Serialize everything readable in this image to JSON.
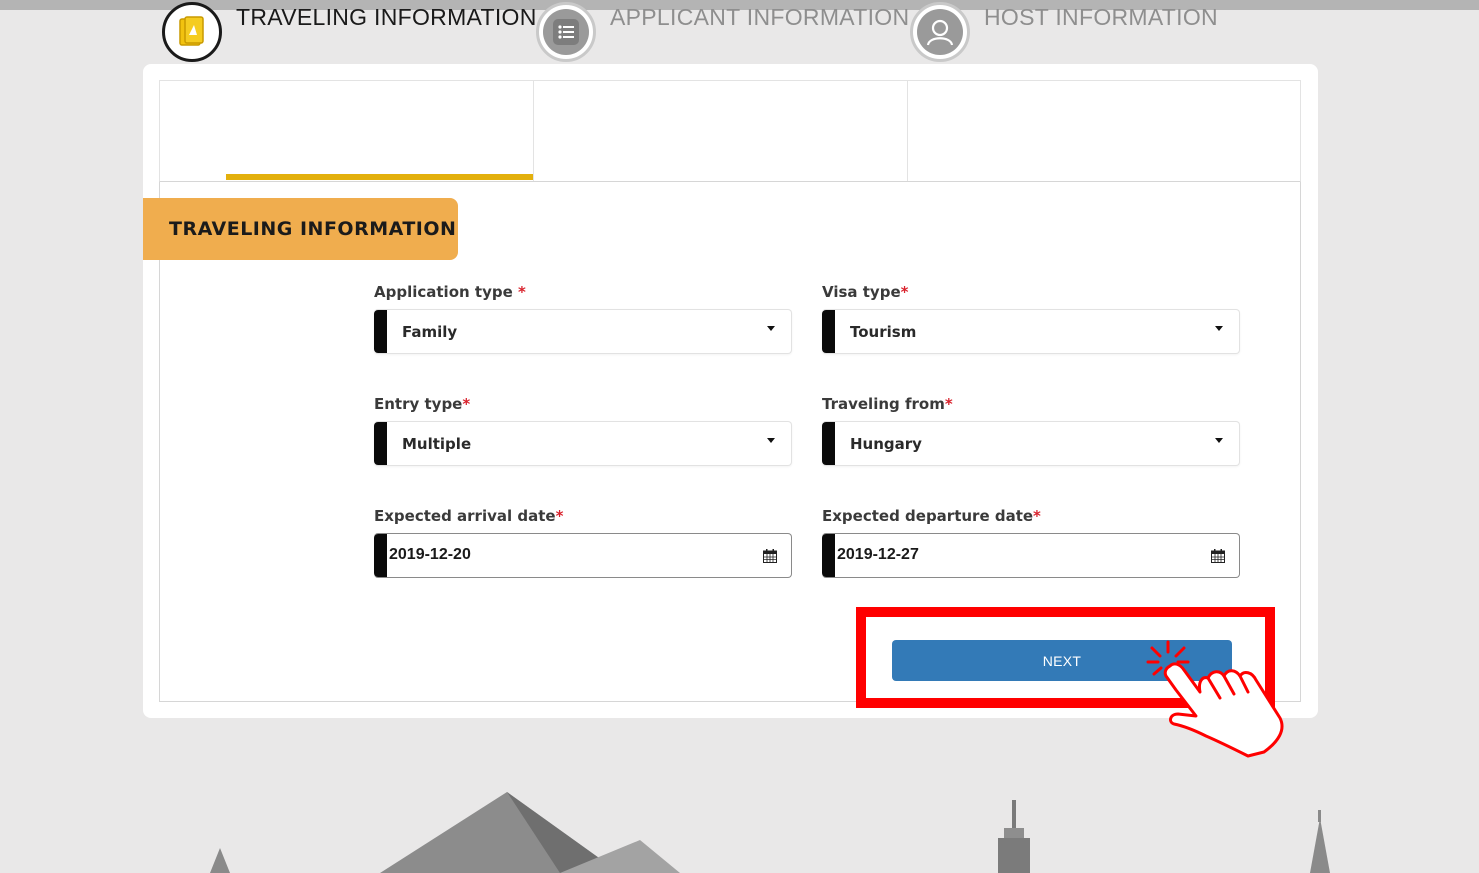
{
  "steps": [
    {
      "label": "TRAVELING INFORMATION",
      "icon": "passport-icon",
      "state": "active"
    },
    {
      "label": "APPLICANT INFORMATION",
      "icon": "list-icon",
      "state": "inactive"
    },
    {
      "label": "HOST INFORMATION",
      "icon": "user-icon",
      "state": "inactive"
    }
  ],
  "section": {
    "title": "TRAVELING INFORMATION"
  },
  "form": {
    "application_type": {
      "label": "Application type ",
      "required": "*",
      "value": "Family"
    },
    "visa_type": {
      "label": "Visa type",
      "required": "*",
      "value": "Tourism"
    },
    "entry_type": {
      "label": "Entry type",
      "required": "*",
      "value": "Multiple"
    },
    "traveling_from": {
      "label": "Traveling from",
      "required": "*",
      "value": "Hungary"
    },
    "arrival_date": {
      "label": "Expected arrival date",
      "required": "*",
      "value": "2019-12-20"
    },
    "departure_date": {
      "label": "Expected departure date",
      "required": "*",
      "value": "2019-12-27"
    }
  },
  "next_button": {
    "label": "NEXT"
  },
  "colors": {
    "accent": "#e3b00d",
    "section_tag": "#f0ad4e",
    "button": "#337ab7",
    "required": "#d9232d",
    "highlight": "#ff0000"
  }
}
